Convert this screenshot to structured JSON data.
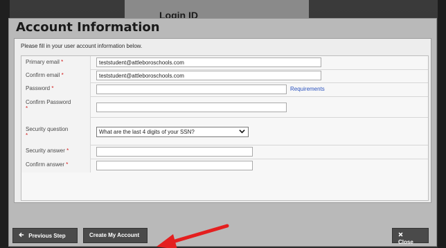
{
  "background": {
    "header_label": "Login ID"
  },
  "dialog": {
    "title": "Account Information",
    "intro": "Please fill in your user account information below.",
    "required_mark": "*",
    "fields": [
      {
        "label": "Primary email",
        "value": "teststudent@attleboroschools.com"
      },
      {
        "label": "Confirm email",
        "value": "teststudent@attleboroschools.com"
      },
      {
        "label": "Password",
        "value": ""
      },
      {
        "label": "Confirm Password",
        "value": ""
      },
      {
        "label": "Security question",
        "value": "What are the last 4 digits of your SSN?"
      },
      {
        "label": "Security answer",
        "value": ""
      },
      {
        "label": "Confirm answer",
        "value": ""
      }
    ],
    "requirements_link": "Requirements"
  },
  "footer": {
    "previous_label": "Previous Step",
    "create_label": "Create My Account",
    "close_label": "Close"
  },
  "colors": {
    "required": "#d21b1b",
    "link": "#2a52be",
    "annotation_arrow": "#e41f1f",
    "button_bg": "#4a4a4a"
  },
  "icons": {
    "previous": "arrow-left-icon",
    "close": "x-icon",
    "select": "chevron-down-icon"
  }
}
